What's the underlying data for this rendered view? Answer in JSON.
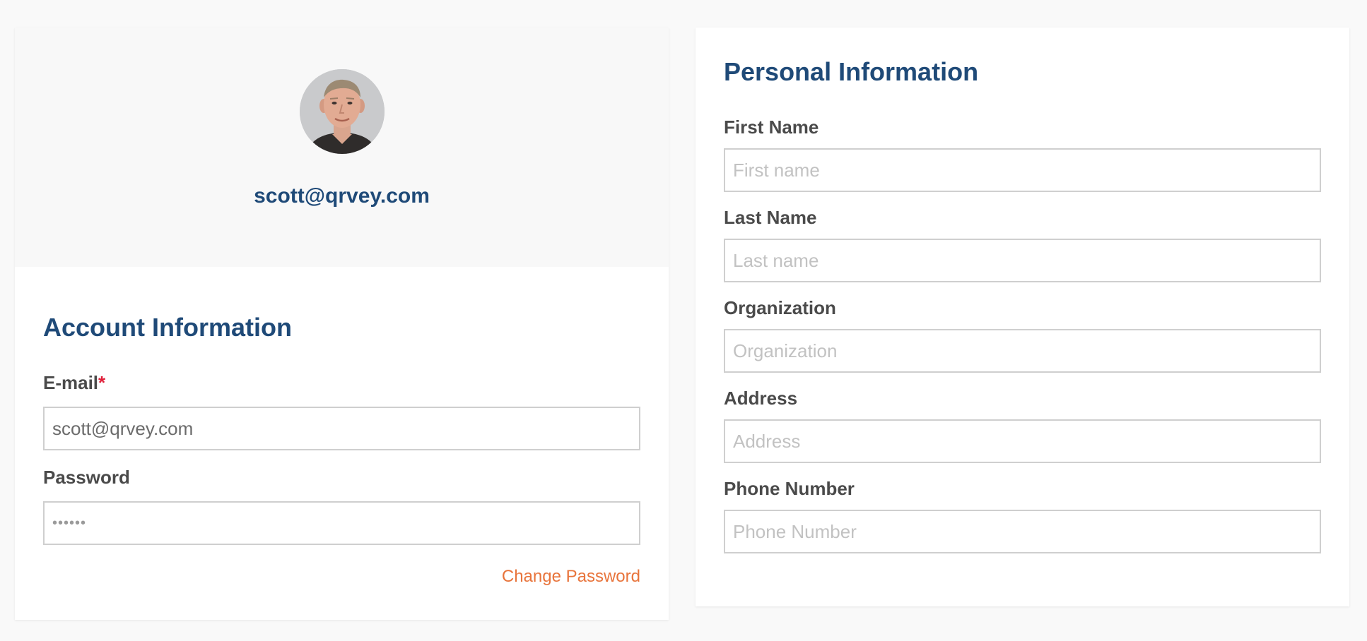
{
  "profile": {
    "email": "scott@qrvey.com"
  },
  "account": {
    "title": "Account Information",
    "email_label": "E-mail",
    "email_required_mark": "*",
    "email_value": "scott@qrvey.com",
    "password_label": "Password",
    "password_value": "••••••",
    "change_password_label": "Change Password"
  },
  "personal": {
    "title": "Personal Information",
    "fields": [
      {
        "label": "First Name",
        "placeholder": "First name"
      },
      {
        "label": "Last Name",
        "placeholder": "Last name"
      },
      {
        "label": "Organization",
        "placeholder": "Organization"
      },
      {
        "label": "Address",
        "placeholder": "Address"
      },
      {
        "label": "Phone Number",
        "placeholder": "Phone Number"
      }
    ]
  },
  "colors": {
    "heading": "#1f4a78",
    "label": "#4a4a4a",
    "link": "#e8743b",
    "required": "#e0203a",
    "page_background": "#f9f9f9"
  }
}
